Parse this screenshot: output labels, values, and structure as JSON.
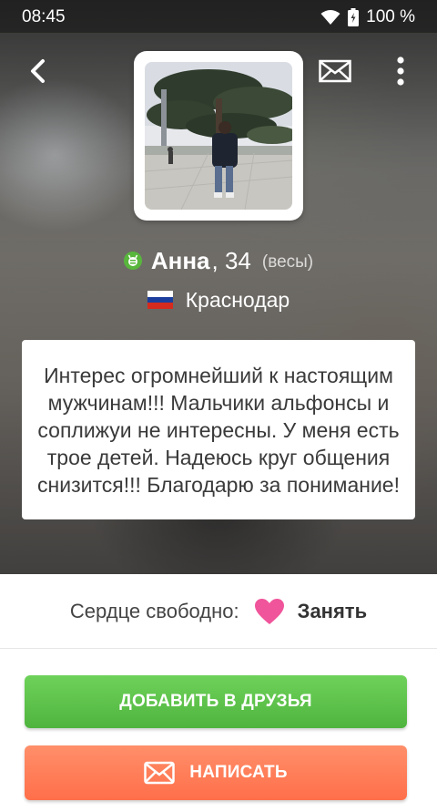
{
  "status_bar": {
    "time": "08:45",
    "battery": "100 %"
  },
  "header": {
    "back_icon": "chevron-left-icon",
    "mail_icon": "envelope-icon",
    "more_icon": "more-vertical-icon"
  },
  "profile": {
    "name": "Анна",
    "age": ", 34",
    "zodiac": "(весы)",
    "city": "Краснодар",
    "online": true,
    "flag_colors": [
      "#ffffff",
      "#1c3f9e",
      "#d52b1e"
    ],
    "about": "Интерес огромнейший к настоящим мужчинам!!! Мальчики альфонсы и соплижуи не интересны. У меня есть трое детей. Надеюсь круг общения снизится!!! Благодарю за понимание!"
  },
  "heart": {
    "label": "Сердце свободно:",
    "status": "Занять",
    "color": "#f0549a"
  },
  "actions": {
    "add_friend": "ДОБАВИТЬ В ДРУЗЬЯ",
    "write": "НАПИСАТЬ"
  },
  "colors": {
    "green": "#58b63d",
    "coral": "#ff7a55"
  }
}
